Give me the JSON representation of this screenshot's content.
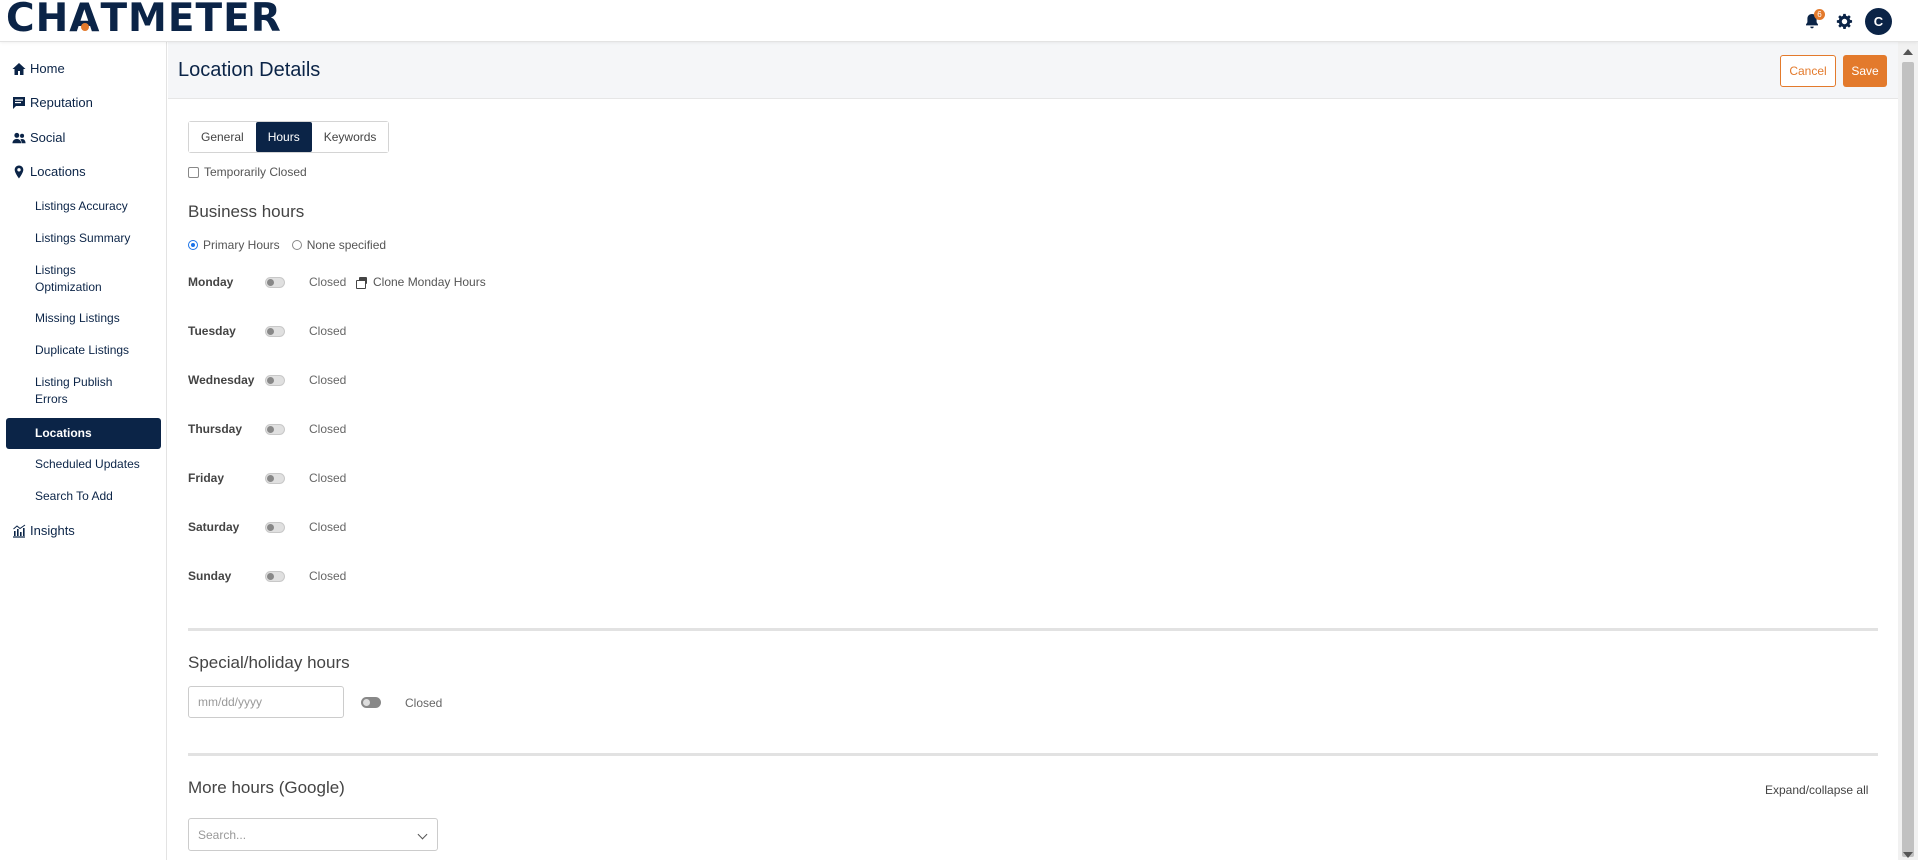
{
  "app": {
    "logo_pre": "CH",
    "logo_a": "A",
    "logo_post": "TMETER",
    "notification_count": "6",
    "avatar_initial": "C",
    "accent_color": "#e37a2c",
    "brand_color": "#0b2447"
  },
  "icons": {
    "bell": "bell-icon",
    "gear": "gear-icon",
    "home": "home-icon",
    "reputation": "message-icon",
    "social": "users-icon",
    "locations": "map-pin-icon",
    "insights": "chart-icon",
    "clone": "copy-icon",
    "dropdown": "chevron-down-icon"
  },
  "sidebar": {
    "main": [
      {
        "label": "Home"
      },
      {
        "label": "Reputation"
      },
      {
        "label": "Social"
      },
      {
        "label": "Locations"
      },
      {
        "label": "Insights"
      }
    ],
    "sub": [
      {
        "label": "Listings Accuracy"
      },
      {
        "label": "Listings Summary"
      },
      {
        "label": "Listings Optimization"
      },
      {
        "label": "Missing Listings"
      },
      {
        "label": "Duplicate Listings"
      },
      {
        "label": "Listing Publish Errors"
      },
      {
        "label": "Locations"
      },
      {
        "label": "Scheduled Updates"
      },
      {
        "label": "Search To Add"
      }
    ],
    "active_sub": "Locations"
  },
  "header": {
    "title": "Location Details",
    "cancel_label": "Cancel",
    "save_label": "Save"
  },
  "tabs": [
    {
      "label": "General"
    },
    {
      "label": "Hours"
    },
    {
      "label": "Keywords"
    }
  ],
  "active_tab": "Hours",
  "temporarily_closed": {
    "label": "Temporarily Closed",
    "checked": false
  },
  "business_hours": {
    "title": "Business hours",
    "options": [
      {
        "label": "Primary Hours",
        "selected": true
      },
      {
        "label": "None specified",
        "selected": false
      }
    ],
    "clone_label": "Clone Monday Hours",
    "days": [
      {
        "name": "Monday",
        "status": "Closed"
      },
      {
        "name": "Tuesday",
        "status": "Closed"
      },
      {
        "name": "Wednesday",
        "status": "Closed"
      },
      {
        "name": "Thursday",
        "status": "Closed"
      },
      {
        "name": "Friday",
        "status": "Closed"
      },
      {
        "name": "Saturday",
        "status": "Closed"
      },
      {
        "name": "Sunday",
        "status": "Closed"
      }
    ]
  },
  "special_hours": {
    "title": "Special/holiday hours",
    "date_placeholder": "mm/dd/yyyy",
    "status": "Closed"
  },
  "more_hours": {
    "title": "More hours (Google)",
    "expand_label": "Expand/collapse all",
    "search_placeholder": "Search..."
  }
}
